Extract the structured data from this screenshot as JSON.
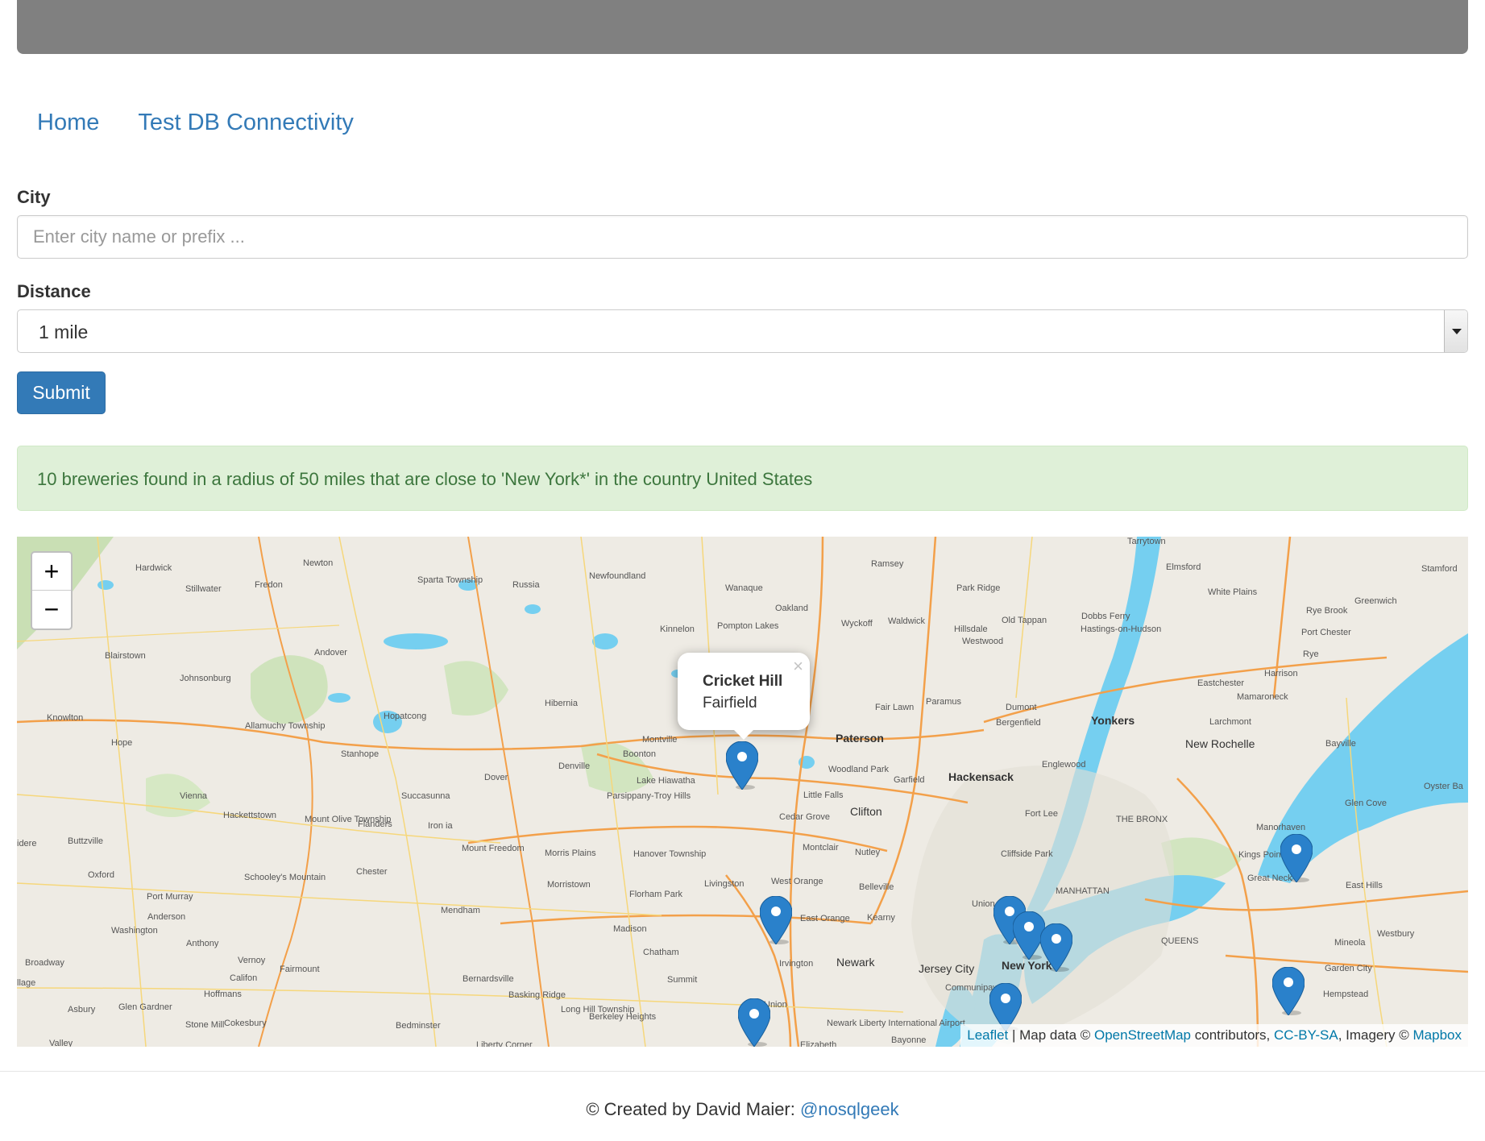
{
  "nav": {
    "home": "Home",
    "test_db": "Test DB Connectivity"
  },
  "form": {
    "city_label": "City",
    "city_placeholder": "Enter city name or prefix ...",
    "city_value": "",
    "distance_label": "Distance",
    "distance_selected": "1 mile",
    "submit_label": "Submit"
  },
  "alert": {
    "message": "10 breweries found in a radius of 50 miles that are close to 'New York*' in the country United States"
  },
  "map": {
    "zoom_in": "+",
    "zoom_out": "−",
    "marker_color": "#2a81cb",
    "popup": {
      "title": "Cricket Hill",
      "subtitle": "Fairfield",
      "close": "×"
    },
    "places": [
      "Hardwick",
      "Newton",
      "Fredon",
      "Stillwater",
      "Sparta Township",
      "Russia",
      "Newfoundland",
      "Wanaque",
      "Ramsey",
      "Park Ridge",
      "Tarrytown",
      "Elmsford",
      "White Plains",
      "Stamford",
      "Greenwich",
      "Rye Brook",
      "Port Chester",
      "Rye",
      "Oakland",
      "Wyckoff",
      "Waldwick",
      "Hillsdale",
      "Westwood",
      "Old Tappan",
      "Dobbs Ferry",
      "Hastings-on-Hudson",
      "Kinnelon",
      "Pompton Lakes",
      "Blairstown",
      "Andover",
      "Johnsonburg",
      "Hibernia",
      "Hopatcong",
      "Knowlton",
      "Allamuchy Township",
      "Hope",
      "Stanhope",
      "Dover",
      "Denville",
      "Montville",
      "Boonton",
      "Lake Hiawatha",
      "Parsippany-Troy Hills",
      "Paterson",
      "Fair Lawn",
      "Paramus",
      "Dumont",
      "Bergenfield",
      "Eastchester",
      "Harrison",
      "Mamaroneck",
      "Larchmont",
      "Yonkers",
      "New Rochelle",
      "Bayville",
      "Oyster Ba",
      "Glen Cove",
      "Manorhaven",
      "Kings Point",
      "Great Neck",
      "East Hills",
      "Woodland Park",
      "Garfield",
      "Hackensack",
      "Englewood",
      "Little Falls",
      "Clifton",
      "Cedar Grove",
      "Fort Lee",
      "THE BRONX",
      "Cliffside Park",
      "Nutley",
      "Montclair",
      "West Orange",
      "Livingston",
      "Belleville",
      "East Orange",
      "Kearny",
      "Union City",
      "MANHATTAN",
      "QUEENS",
      "Westbury",
      "Mineola",
      "Garden City",
      "Hempstead",
      "Newark",
      "Jersey City",
      "New York",
      "Communipaw",
      "Irvington",
      "Union",
      "Elizabeth",
      "Bayonne",
      "Newark Liberty International Airport",
      "Vienna",
      "Hackettstown",
      "Mount Olive Township",
      "Flanders",
      "Succasunna",
      "Iron ia",
      "Mount Freedom",
      "Morris Plains",
      "Hanover Township",
      "Morristown",
      "Florham Park",
      "Madison",
      "Chatham",
      "Summit",
      "Oxford",
      "Buttzville",
      "Washington",
      "Port Murray",
      "Anderson",
      "Anthony",
      "Vernoy",
      "Califon",
      "Fairmount",
      "Hoffmans",
      "Glen Gardner",
      "Stone Mill",
      "Cokesbury",
      "Chester",
      "Mendham",
      "Bernardsville",
      "Basking Ridge",
      "Long Hill Township",
      "Berkeley Heights",
      "Bedminster",
      "Asbury",
      "Broadway",
      "Valley",
      "Schooley's Mountain",
      "idere",
      "llage",
      "Liberty Corner"
    ],
    "attribution": {
      "leaflet": "Leaflet",
      "sep": " | Map data © ",
      "osm": "OpenStreetMap",
      "contrib": " contributors, ",
      "license": "CC-BY-SA",
      "imagery": ", Imagery © ",
      "mapbox": "Mapbox"
    }
  },
  "footer": {
    "text": "© Created by David Maier: ",
    "handle": "@nosqlgeek"
  }
}
